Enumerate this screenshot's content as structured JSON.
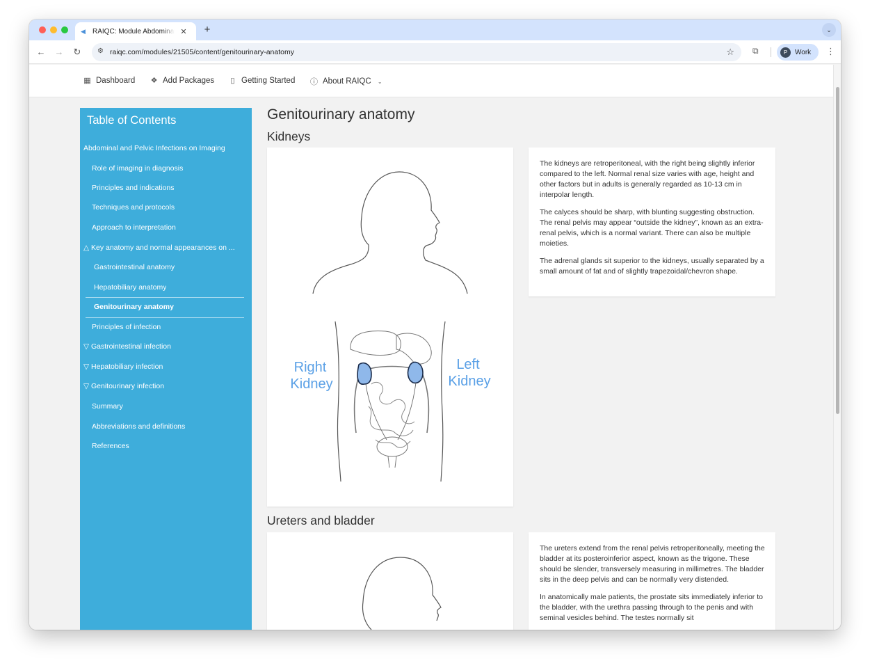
{
  "browser": {
    "tab_title": "RAIQC: Module Abdominal and Pelvic Infections on Imaging",
    "url": "raiqc.com/modules/21505/content/genitourinary-anatomy",
    "profile_initial": "P",
    "profile_label": "Work"
  },
  "sitenav": {
    "items": [
      {
        "label": "Dashboard",
        "icon": "grid-icon"
      },
      {
        "label": "Add Packages",
        "icon": "package-icon"
      },
      {
        "label": "Getting Started",
        "icon": "book-icon"
      },
      {
        "label": "About RAIQC",
        "icon": "info-icon"
      }
    ]
  },
  "toc": {
    "title": "Table of Contents",
    "items": [
      {
        "label": "Abdominal and Pelvic Infections on Imaging"
      },
      {
        "label": "Role of imaging in diagnosis"
      },
      {
        "label": "Principles and indications"
      },
      {
        "label": "Techniques and protocols"
      },
      {
        "label": "Approach to interpretation"
      },
      {
        "label": "△ Key anatomy and normal appearances on ..."
      },
      {
        "label": "Gastrointestinal anatomy"
      },
      {
        "label": "Hepatobiliary anatomy"
      },
      {
        "label": "Genitourinary anatomy"
      },
      {
        "label": "Principles of infection"
      },
      {
        "label": "▽ Gastrointestinal infection"
      },
      {
        "label": "▽ Hepatobiliary infection"
      },
      {
        "label": "▽ Genitourinary infection"
      },
      {
        "label": "Summary"
      },
      {
        "label": "Abbreviations and definitions"
      },
      {
        "label": "References"
      }
    ]
  },
  "main": {
    "title": "Genitourinary anatomy",
    "sections": [
      {
        "heading": "Kidneys",
        "figure_labels": {
          "right": [
            "Right",
            "Kidney"
          ],
          "left": [
            "Left",
            "Kidney"
          ]
        },
        "paragraphs": [
          "The kidneys are retroperitoneal, with the right being slightly inferior compared to the left. Normal renal size varies with age, height and other factors but in adults is generally regarded as 10-13 cm in interpolar length.",
          "The calyces should be sharp, with blunting suggesting obstruction. The renal pelvis may appear “outside the kidney”, known as an extra-renal pelvis, which is a normal variant. There can also be multiple moieties.",
          "The adrenal glands sit superior to the kidneys, usually separated by a small amount of fat and of slightly trapezoidal/chevron shape."
        ]
      },
      {
        "heading": "Ureters and bladder",
        "paragraphs": [
          "The ureters extend from the renal pelvis retroperitoneally, meeting the bladder at its posteroinferior aspect, known as the trigone. These should be slender, transversely measuring in millimetres. The bladder sits in the deep pelvis and can be normally very distended.",
          "In anatomically male patients, the prostate sits immediately inferior to the bladder, with the urethra passing through to the penis and with seminal vesicles behind. The testes normally sit"
        ]
      }
    ]
  },
  "colors": {
    "toc_bg": "#3eaddb",
    "kidney_fill": "#8fb8ea",
    "label_blue": "#5aa0e6"
  }
}
